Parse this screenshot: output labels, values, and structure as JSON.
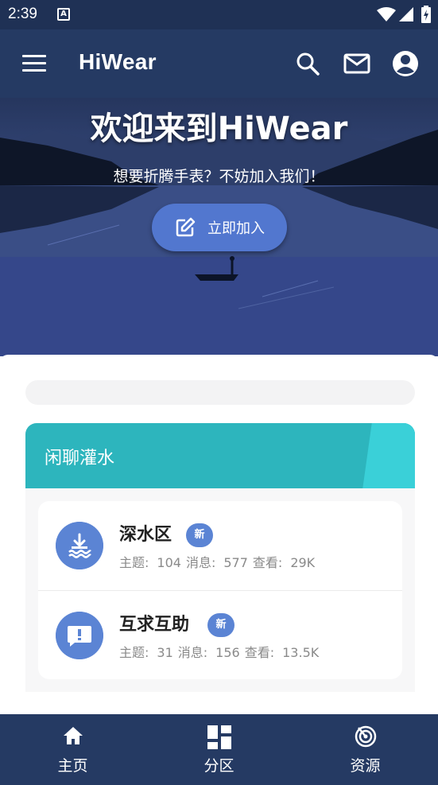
{
  "status_bar": {
    "time": "2:39",
    "notification_letter": "A"
  },
  "app_bar": {
    "title": "HiWear",
    "icons": [
      "menu-icon",
      "search-icon",
      "mail-icon",
      "account-icon"
    ]
  },
  "hero": {
    "title": "欢迎来到HiWear",
    "subtitle": "想要折腾手表？不妨加入我们！",
    "join_button": "立即加入"
  },
  "category": {
    "title": "闲聊灌水",
    "forums": [
      {
        "name": "深水区",
        "badge": "新",
        "topics_label": "主题:",
        "topics": "104",
        "messages_label": "消息:",
        "messages": "577",
        "views_label": "查看:",
        "views": "29K",
        "icon": "water-download-icon"
      },
      {
        "name": "互求互助",
        "badge": "新",
        "topics_label": "主题:",
        "topics": "31",
        "messages_label": "消息:",
        "messages": "156",
        "views_label": "查看:",
        "views": "13.5K",
        "icon": "help-chat-icon"
      }
    ]
  },
  "bottom_nav": [
    {
      "label": "主页",
      "icon": "home-icon"
    },
    {
      "label": "分区",
      "icon": "dashboard-icon"
    },
    {
      "label": "资源",
      "icon": "radar-icon"
    }
  ],
  "colors": {
    "primary": "#253a63",
    "accent": "#5b84d4",
    "teal": "#2db5bd"
  }
}
